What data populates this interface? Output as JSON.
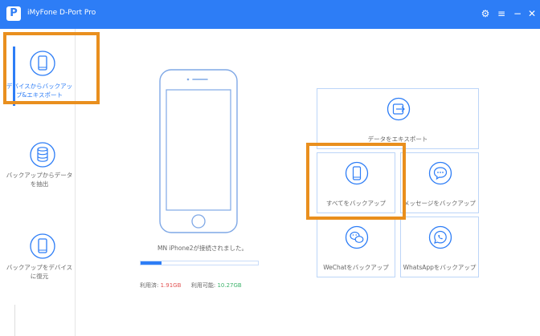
{
  "app": {
    "title": "iMyFone D-Port Pro",
    "logo_letter": "P"
  },
  "titlebar": {
    "settings_icon": "⚙",
    "menu_icon": "≡",
    "minimize_icon": "−",
    "close_icon": "✕"
  },
  "sidebar": {
    "items": [
      {
        "label_line1": "デバイスからバックアッ",
        "label_line2": "プ&エキスポート",
        "icon": "phone-export-icon"
      },
      {
        "label_line1": "バックアップからデータ",
        "label_line2": "を抽出",
        "icon": "database-icon"
      },
      {
        "label_line1": "バックアップをデバイス",
        "label_line2": "に復元",
        "icon": "phone-restore-icon"
      }
    ]
  },
  "device": {
    "status": "MN iPhone2が接続されました。",
    "progress": 0.18,
    "used_label": "利用済:",
    "used_value": "1.91GB",
    "available_label": "利用可能:",
    "available_value": "10.27GB"
  },
  "actions": {
    "export": {
      "label": "データをエキスポート",
      "icon": "export-icon"
    },
    "backup_all": {
      "label": "すべてをバックアップ",
      "icon": "phone-icon"
    },
    "backup_messages": {
      "label": "メッセージをバックアップ",
      "icon": "message-icon"
    },
    "backup_wechat": {
      "label": "WeChatをバックアップ",
      "icon": "wechat-icon"
    },
    "backup_whatsapp": {
      "label": "WhatsAppをバックアップ",
      "icon": "whatsapp-icon"
    }
  },
  "colors": {
    "brand": "#2d7df6",
    "highlight": "#e98f1e",
    "used": "#e25252",
    "available": "#3db36b"
  }
}
